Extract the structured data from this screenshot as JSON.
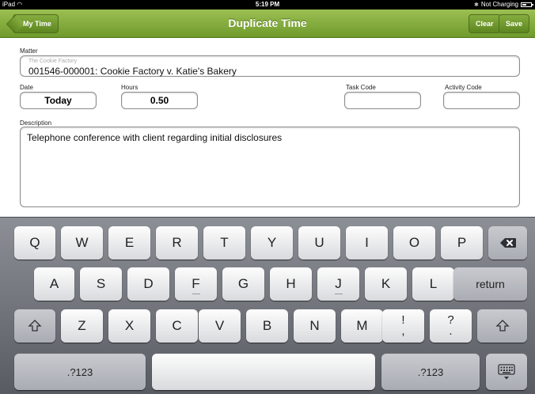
{
  "status_bar": {
    "device": "iPad",
    "time": "5:19 PM",
    "battery": "Not Charging"
  },
  "nav": {
    "back_label": "My Time",
    "title": "Duplicate Time",
    "clear_label": "Clear",
    "save_label": "Save"
  },
  "form": {
    "matter": {
      "label": "Matter",
      "client": "The Cookie Factory",
      "value": "001546-000001: Cookie Factory v. Katie's Bakery"
    },
    "date": {
      "label": "Date",
      "value": "Today"
    },
    "hours": {
      "label": "Hours",
      "value": "0.50"
    },
    "task_code": {
      "label": "Task Code",
      "value": ""
    },
    "activity_code": {
      "label": "Activity Code",
      "value": ""
    },
    "description": {
      "label": "Description",
      "value": "Telephone conference with client regarding initial disclosures"
    }
  },
  "keyboard": {
    "row1": [
      "Q",
      "W",
      "E",
      "R",
      "T",
      "Y",
      "U",
      "I",
      "O",
      "P"
    ],
    "row2": [
      "A",
      "S",
      "D",
      "F",
      "G",
      "H",
      "J",
      "K",
      "L"
    ],
    "row3": [
      "Z",
      "X",
      "C",
      "V",
      "B",
      "N",
      "M"
    ],
    "punct1": [
      "!",
      ","
    ],
    "punct2": [
      "?",
      "."
    ],
    "return_label": "return",
    "numbers_label": ".?123",
    "numbers_label_right": ".?123",
    "icons": {
      "backspace": "backspace-icon",
      "shift": "shift-icon",
      "hide": "keyboard-hide-icon"
    }
  }
}
